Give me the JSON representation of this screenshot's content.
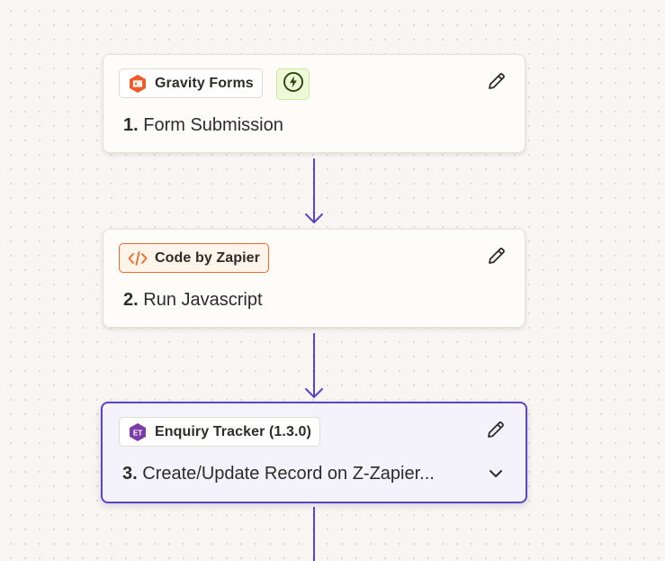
{
  "colors": {
    "accent": "#5a45c5",
    "canvas_bg": "#f7f6f2",
    "gravity_brand": "#f15a29",
    "code_brand": "#f06a2a",
    "enquiry_brand": "#7b3ea8",
    "trigger_green": "#2d4a12"
  },
  "steps": [
    {
      "app_name": "Gravity Forms",
      "app_icon": "gravity-forms-icon",
      "number": "1.",
      "title": "Form Submission",
      "is_trigger": true,
      "trigger_icon": "lightning-bolt-icon",
      "edit_icon": "pencil-icon"
    },
    {
      "app_name": "Code by Zapier",
      "app_icon": "code-brackets-icon",
      "number": "2.",
      "title": "Run Javascript",
      "edit_icon": "pencil-icon"
    },
    {
      "app_name": "Enquiry Tracker (1.3.0)",
      "app_icon": "enquiry-tracker-icon",
      "app_icon_text": "ET",
      "number": "3.",
      "title": "Create/Update Record on Z-Zapier...",
      "selected": true,
      "edit_icon": "pencil-icon",
      "expand_icon": "chevron-down-icon"
    }
  ]
}
